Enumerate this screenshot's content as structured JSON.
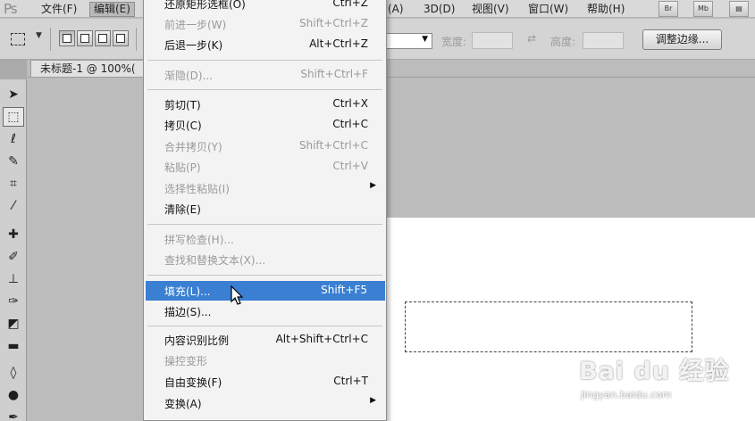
{
  "app": {
    "logo": "Ps"
  },
  "menubar": {
    "items": [
      {
        "label": "文件(F)"
      },
      {
        "label": "编辑(E)"
      },
      {
        "label": "(A)"
      },
      {
        "label": "3D(D)"
      },
      {
        "label": "视图(V)"
      },
      {
        "label": "窗口(W)"
      },
      {
        "label": "帮助(H)"
      }
    ],
    "app_buttons": [
      "Br",
      "Mb"
    ]
  },
  "options_bar": {
    "width_label": "宽度:",
    "height_label": "高度:",
    "refine_edge_button": "调整边缘..."
  },
  "document": {
    "tab_title": "未标题-1 @ 100%("
  },
  "edit_menu": {
    "items": [
      {
        "label": "还原矩形选框(O)",
        "shortcut": "Ctrl+Z",
        "disabled": false
      },
      {
        "label": "前进一步(W)",
        "shortcut": "Shift+Ctrl+Z",
        "disabled": true
      },
      {
        "label": "后退一步(K)",
        "shortcut": "Alt+Ctrl+Z",
        "disabled": false
      },
      {
        "label": "渐隐(D)...",
        "shortcut": "Shift+Ctrl+F",
        "disabled": true
      },
      {
        "label": "剪切(T)",
        "shortcut": "Ctrl+X",
        "disabled": false
      },
      {
        "label": "拷贝(C)",
        "shortcut": "Ctrl+C",
        "disabled": false
      },
      {
        "label": "合并拷贝(Y)",
        "shortcut": "Shift+Ctrl+C",
        "disabled": true
      },
      {
        "label": "粘贴(P)",
        "shortcut": "Ctrl+V",
        "disabled": true
      },
      {
        "label": "选择性粘贴(I)",
        "shortcut": "",
        "disabled": true,
        "submenu": true
      },
      {
        "label": "清除(E)",
        "shortcut": "",
        "disabled": false
      },
      {
        "label": "拼写检查(H)...",
        "shortcut": "",
        "disabled": true
      },
      {
        "label": "查找和替换文本(X)...",
        "shortcut": "",
        "disabled": true
      },
      {
        "label": "填充(L)...",
        "shortcut": "Shift+F5",
        "disabled": false,
        "highlighted": true
      },
      {
        "label": "描边(S)...",
        "shortcut": "",
        "disabled": false
      },
      {
        "label": "内容识别比例",
        "shortcut": "Alt+Shift+Ctrl+C",
        "disabled": false
      },
      {
        "label": "操控变形",
        "shortcut": "",
        "disabled": true
      },
      {
        "label": "自由变换(F)",
        "shortcut": "Ctrl+T",
        "disabled": false
      },
      {
        "label": "变换(A)",
        "shortcut": "",
        "disabled": false,
        "submenu": true
      }
    ]
  },
  "watermark": {
    "main": "Bai du 经验",
    "sub": "jingyan.baidu.com"
  },
  "colors": {
    "highlight": "#3a7fd2",
    "menu_bg": "#f3f3f3",
    "canvas": "#ffffff",
    "workspace": "#bcbcbc"
  },
  "toolbox": {
    "tools": [
      "move-tool",
      "rectangular-marquee-tool",
      "lasso-tool",
      "quick-selection-tool",
      "crop-tool",
      "eyedropper-tool",
      "healing-brush-tool",
      "brush-tool",
      "clone-stamp-tool",
      "history-brush-tool",
      "eraser-tool",
      "gradient-tool",
      "blur-tool",
      "dodge-tool"
    ]
  }
}
